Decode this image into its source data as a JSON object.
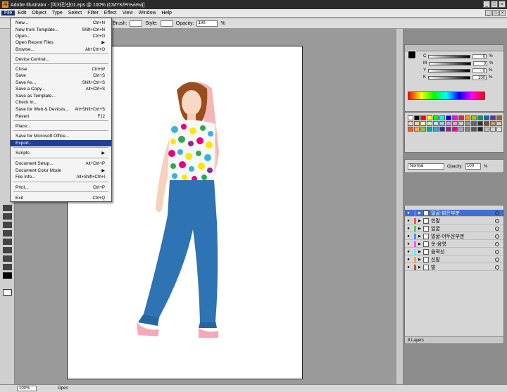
{
  "window": {
    "title": "Adobe Illustrator - [여자전신01.eps @ 100% (CMYK/Preview)]",
    "app_icon": "Ai",
    "controls": [
      "_",
      "□",
      "×"
    ]
  },
  "menubar": {
    "items": [
      "File",
      "Edit",
      "Object",
      "Type",
      "Select",
      "Filter",
      "Effect",
      "View",
      "Window",
      "Help"
    ],
    "doc_controls": [
      "_",
      "□",
      "×"
    ]
  },
  "controlbar": {
    "brush_label": "Brush:",
    "style_label": "Style:",
    "opacity_label": "Opacity:",
    "opacity_value": "100",
    "opacity_unit": "%"
  },
  "file_menu": {
    "items": [
      {
        "label": "New...",
        "shortcut": "Ctrl+N"
      },
      {
        "label": "New from Template...",
        "shortcut": "Shift+Ctrl+N"
      },
      {
        "label": "Open...",
        "shortcut": "Ctrl+O"
      },
      {
        "label": "Open Recent Files",
        "shortcut": "▶"
      },
      {
        "label": "Browse...",
        "shortcut": "Alt+Ctrl+O"
      },
      {
        "label": "Device Central...",
        "shortcut": ""
      },
      {
        "label": "Close",
        "shortcut": "Ctrl+W"
      },
      {
        "label": "Save",
        "shortcut": "Ctrl+S"
      },
      {
        "label": "Save As...",
        "shortcut": "Shift+Ctrl+S"
      },
      {
        "label": "Save a Copy...",
        "shortcut": "Alt+Ctrl+S"
      },
      {
        "label": "Save as Template...",
        "shortcut": ""
      },
      {
        "label": "Check In...",
        "shortcut": ""
      },
      {
        "label": "Save for Web & Devices...",
        "shortcut": "Alt+Shift+Ctrl+S"
      },
      {
        "label": "Revert",
        "shortcut": "F12"
      },
      {
        "label": "Place...",
        "shortcut": ""
      },
      {
        "label": "Save for Microsoft Office...",
        "shortcut": ""
      },
      {
        "label": "Export...",
        "shortcut": ""
      },
      {
        "label": "Scripts",
        "shortcut": "▶"
      },
      {
        "label": "Document Setup...",
        "shortcut": "Alt+Ctrl+P"
      },
      {
        "label": "Document Color Mode",
        "shortcut": "▶"
      },
      {
        "label": "File Info...",
        "shortcut": "Alt+Shift+Ctrl+I"
      },
      {
        "label": "Print...",
        "shortcut": "Ctrl+P"
      },
      {
        "label": "Exit",
        "shortcut": "Ctrl+Q"
      }
    ]
  },
  "color_panel": {
    "channels": [
      {
        "label": "C",
        "value": "0",
        "unit": "%"
      },
      {
        "label": "M",
        "value": "0",
        "unit": "%"
      },
      {
        "label": "Y",
        "value": "0",
        "unit": "%"
      },
      {
        "label": "K",
        "value": "100",
        "unit": "%"
      }
    ]
  },
  "swatches": [
    "#ffffff",
    "#000000",
    "#ff0000",
    "#ffff00",
    "#00ff00",
    "#00ffff",
    "#0000ff",
    "#ff00ff",
    "#cc3333",
    "#ff9900",
    "#99cc00",
    "#009966",
    "#0066cc",
    "#663399",
    "#996633",
    "#ffcccc",
    "#ffcc99",
    "#ffff99",
    "#ccffcc",
    "#99ffff",
    "#99ccff",
    "#cc99ff",
    "#ff99cc",
    "#cccccc",
    "#999999",
    "#666666",
    "#333333",
    "#7a5230",
    "#c49a6c",
    "#e0c9a6",
    "#f05a28",
    "#fbb040",
    "#8dc63f",
    "#00a79d",
    "#27aae1",
    "#2e3192",
    "#92278f",
    "#ec008c",
    "#a7a9ac",
    "#808285",
    "#58595b",
    "#231f20",
    "#bcbec0",
    "#d1d3d4",
    "#e6e7e8"
  ],
  "transparency_panel": {
    "blend_mode": "Normal",
    "opacity_label": "Opacity:",
    "opacity_value": "100",
    "opacity_unit": "%"
  },
  "layers_panel": {
    "layers": [
      {
        "name": "얼굴-밝은부분",
        "color": "#4f7fff"
      },
      {
        "name": "헌팔",
        "color": "#ff4f4f"
      },
      {
        "name": "얼굴",
        "color": "#4fcf4f"
      },
      {
        "name": "얼굴-어두운부분",
        "color": "#4f8fff"
      },
      {
        "name": "옷-음영",
        "color": "#ff4fff"
      },
      {
        "name": "음곽선",
        "color": "#4fffff"
      },
      {
        "name": "신발",
        "color": "#ff9f4f"
      },
      {
        "name": "발",
        "color": "#bf4f4f"
      }
    ],
    "footer": "8 Layers"
  },
  "statusbar": {
    "zoom": "100%",
    "status": "Open"
  }
}
